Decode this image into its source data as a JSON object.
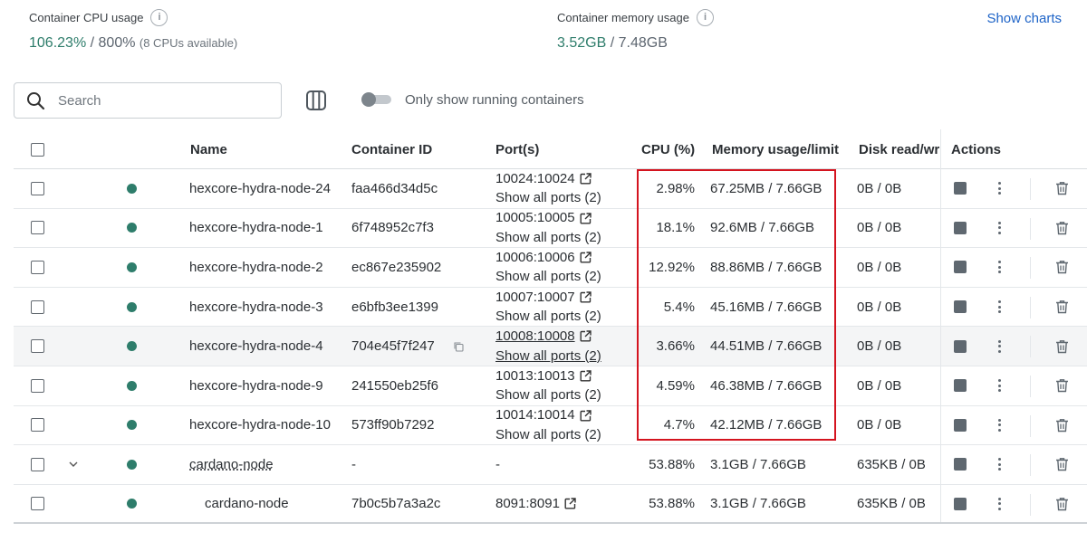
{
  "stats": {
    "cpu": {
      "label": "Container CPU usage",
      "value": "106.23%",
      "sep": " / ",
      "total": "800%",
      "note": "(8 CPUs available)"
    },
    "memory": {
      "label": "Container memory usage",
      "value": "3.52GB",
      "sep": " / ",
      "total": "7.48GB"
    },
    "show_charts": "Show charts",
    "info_glyph": "i"
  },
  "toolbar": {
    "search_placeholder": "Search",
    "toggle_label": "Only show running containers",
    "toggle_on": false
  },
  "table": {
    "headers": {
      "name": "Name",
      "container_id": "Container ID",
      "ports": "Port(s)",
      "cpu": "CPU (%)",
      "memory": "Memory usage/limit",
      "disk": "Disk read/write",
      "actions": "Actions"
    },
    "rows": [
      {
        "name": "hexcore-hydra-node-24",
        "container_id": "faa466d34d5c",
        "port": "10024:10024",
        "ports_more": "Show all ports (2)",
        "cpu": "2.98%",
        "memory": "67.25MB / 7.66GB",
        "disk": "0B / 0B"
      },
      {
        "name": "hexcore-hydra-node-1",
        "container_id": "6f748952c7f3",
        "port": "10005:10005",
        "ports_more": "Show all ports (2)",
        "cpu": "18.1%",
        "memory": "92.6MB / 7.66GB",
        "disk": "0B / 0B"
      },
      {
        "name": "hexcore-hydra-node-2",
        "container_id": "ec867e235902",
        "port": "10006:10006",
        "ports_more": "Show all ports (2)",
        "cpu": "12.92%",
        "memory": "88.86MB / 7.66GB",
        "disk": "0B / 0B"
      },
      {
        "name": "hexcore-hydra-node-3",
        "container_id": "e6bfb3ee1399",
        "port": "10007:10007",
        "ports_more": "Show all ports (2)",
        "cpu": "5.4%",
        "memory": "45.16MB / 7.66GB",
        "disk": "0B / 0B"
      },
      {
        "name": "hexcore-hydra-node-4",
        "container_id": "704e45f7f247",
        "port": "10008:10008",
        "ports_more": "Show all ports (2)",
        "cpu": "3.66%",
        "memory": "44.51MB / 7.66GB",
        "disk": "0B / 0B"
      },
      {
        "name": "hexcore-hydra-node-9",
        "container_id": "241550eb25f6",
        "port": "10013:10013",
        "ports_more": "Show all ports (2)",
        "cpu": "4.59%",
        "memory": "46.38MB / 7.66GB",
        "disk": "0B / 0B"
      },
      {
        "name": "hexcore-hydra-node-10",
        "container_id": "573ff90b7292",
        "port": "10014:10014",
        "ports_more": "Show all ports (2)",
        "cpu": "4.7%",
        "memory": "42.12MB / 7.66GB",
        "disk": "0B / 0B"
      }
    ],
    "group": {
      "name": "cardano-node",
      "container_id": "-",
      "port": "-",
      "cpu": "53.88%",
      "memory": "3.1GB / 7.66GB",
      "disk": "635KB / 0B"
    },
    "child": {
      "name": "cardano-node",
      "container_id": "7b0c5b7a3a2c",
      "port": "8091:8091",
      "cpu": "53.88%",
      "memory": "3.1GB / 7.66GB",
      "disk": "635KB / 0B"
    }
  },
  "colors": {
    "accent": "#1d63c7",
    "running": "#2e7d6b",
    "highlight_box": "#d4141f"
  },
  "icons": [
    "info-icon",
    "search-icon",
    "columns-icon",
    "external-link-icon",
    "copy-icon",
    "chevron-down-icon",
    "stop-icon",
    "more-vertical-icon",
    "trash-icon"
  ]
}
